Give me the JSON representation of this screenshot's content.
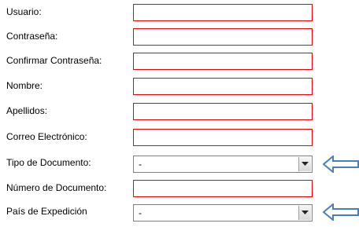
{
  "form": {
    "fields": [
      {
        "label": "Usuario:",
        "value": ""
      },
      {
        "label": "Contraseña:",
        "value": ""
      },
      {
        "label": "Confirmar Contraseña:",
        "value": ""
      },
      {
        "label": "Nombre:",
        "value": ""
      },
      {
        "label": "Apellidos:",
        "value": ""
      },
      {
        "label": "Correo Electrónico:",
        "value": ""
      },
      {
        "label": "Tipo de Documento:",
        "selected": "-"
      },
      {
        "label": "Número de Documento:",
        "value": ""
      },
      {
        "label": "País de Expedición",
        "selected": "-"
      }
    ]
  },
  "colors": {
    "required_border": "#e8000d",
    "arrow_annotation": "#4a7ebb"
  },
  "icons": {
    "dropdown": "chevron-down-icon",
    "annotation": "arrow-left-icon"
  }
}
